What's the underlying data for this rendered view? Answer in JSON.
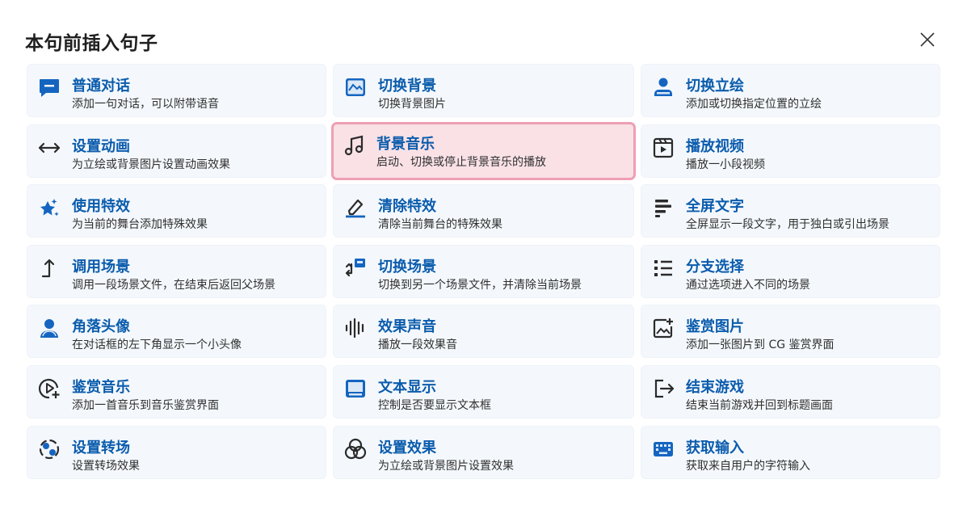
{
  "dialog": {
    "title": "本句前插入句子",
    "close_icon": "close-icon"
  },
  "colors": {
    "card_bg": "#f4f8fc",
    "title_blue": "#0b5cad",
    "icon_blue": "#1565c0",
    "selected_bg": "#f9e1e6",
    "selected_border": "#ef9fb4"
  },
  "items": [
    {
      "title": "普通对话",
      "desc": "添加一句对话，可以附带语音",
      "icon": "chat-icon"
    },
    {
      "title": "切换背景",
      "desc": "切换背景图片",
      "icon": "image-icon"
    },
    {
      "title": "切换立绘",
      "desc": "添加或切换指定位置的立绘",
      "icon": "person-icon"
    },
    {
      "title": "设置动画",
      "desc": "为立绘或背景图片设置动画效果",
      "icon": "arrows-horizontal-icon"
    },
    {
      "title": "背景音乐",
      "desc": "启动、切换或停止背景音乐的播放",
      "icon": "music-note-icon",
      "selected": true
    },
    {
      "title": "播放视频",
      "desc": "播放一小段视频",
      "icon": "video-icon"
    },
    {
      "title": "使用特效",
      "desc": "为当前的舞台添加特殊效果",
      "icon": "sparkle-star-icon"
    },
    {
      "title": "清除特效",
      "desc": "清除当前舞台的特殊效果",
      "icon": "eraser-icon"
    },
    {
      "title": "全屏文字",
      "desc": "全屏显示一段文字，用于独白或引出场景",
      "icon": "text-align-icon"
    },
    {
      "title": "调用场景",
      "desc": "调用一段场景文件，在结束后返回父场景",
      "icon": "arrow-up-turn-icon"
    },
    {
      "title": "切换场景",
      "desc": "切换到另一个场景文件，并清除当前场景",
      "icon": "scene-switch-icon"
    },
    {
      "title": "分支选择",
      "desc": "通过选项进入不同的场景",
      "icon": "list-icon"
    },
    {
      "title": "角落头像",
      "desc": "在对话框的左下角显示一个小头像",
      "icon": "avatar-icon"
    },
    {
      "title": "效果声音",
      "desc": "播放一段效果音",
      "icon": "sound-wave-icon"
    },
    {
      "title": "鉴赏图片",
      "desc": "添加一张图片到 CG 鉴赏界面",
      "icon": "image-add-icon"
    },
    {
      "title": "鉴赏音乐",
      "desc": "添加一首音乐到音乐鉴赏界面",
      "icon": "play-add-icon"
    },
    {
      "title": "文本显示",
      "desc": "控制是否要显示文本框",
      "icon": "textbox-icon"
    },
    {
      "title": "结束游戏",
      "desc": "结束当前游戏并回到标题画面",
      "icon": "exit-icon"
    },
    {
      "title": "设置转场",
      "desc": "设置转场效果",
      "icon": "transition-icon"
    },
    {
      "title": "设置效果",
      "desc": "为立绘或背景图片设置效果",
      "icon": "color-circles-icon"
    },
    {
      "title": "获取输入",
      "desc": "获取来自用户的字符输入",
      "icon": "keyboard-icon"
    }
  ]
}
